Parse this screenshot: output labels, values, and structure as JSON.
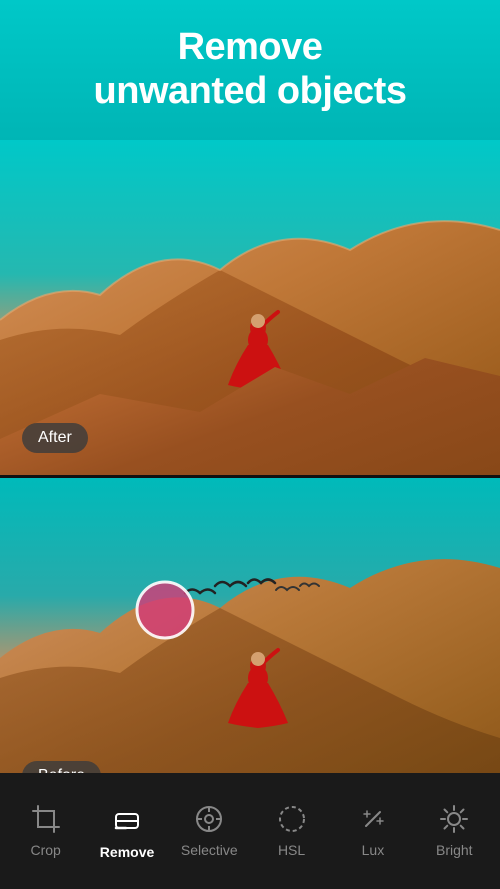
{
  "header": {
    "title_line1": "Remove",
    "title_line2": "unwanted objects",
    "bg_color": "#00c2c2"
  },
  "after_panel": {
    "badge": "After"
  },
  "before_panel": {
    "badge": "Before"
  },
  "toolbar": {
    "items": [
      {
        "id": "crop",
        "label": "Crop",
        "icon": "crop-icon",
        "active": false
      },
      {
        "id": "remove",
        "label": "Remove",
        "icon": "remove-icon",
        "active": true
      },
      {
        "id": "selective",
        "label": "Selective",
        "icon": "selective-icon",
        "active": false
      },
      {
        "id": "hsl",
        "label": "HSL",
        "icon": "hsl-icon",
        "active": false
      },
      {
        "id": "lux",
        "label": "Lux",
        "icon": "lux-icon",
        "active": false
      },
      {
        "id": "bright",
        "label": "Bright",
        "icon": "bright-icon",
        "active": false
      }
    ]
  }
}
